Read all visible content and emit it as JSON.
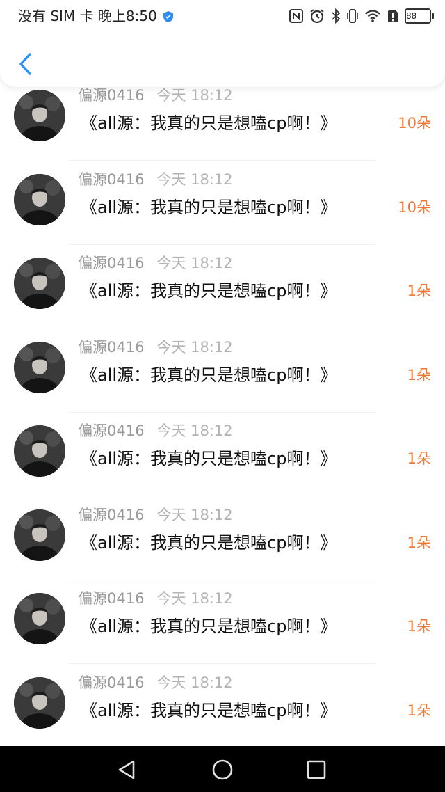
{
  "status_bar": {
    "left_text": "没有 SIM 卡 晚上8:50",
    "battery_level": "88",
    "icons": [
      "shield-icon",
      "nfc-icon",
      "alarm-icon",
      "bluetooth-icon",
      "vibrate-icon",
      "wifi-icon",
      "sim-alert-icon",
      "battery-icon"
    ]
  },
  "header": {
    "back_icon": "chevron-left-icon"
  },
  "colors": {
    "accent_blue": "#2b8ff5",
    "count_orange": "#ee7a36"
  },
  "list": {
    "items": [
      {
        "user": "偏源0416",
        "time": "今天 18:12",
        "title": "《all源：我真的只是想嗑cp啊！》",
        "count": "10朵"
      },
      {
        "user": "偏源0416",
        "time": "今天 18:12",
        "title": "《all源：我真的只是想嗑cp啊！》",
        "count": "10朵"
      },
      {
        "user": "偏源0416",
        "time": "今天 18:12",
        "title": "《all源：我真的只是想嗑cp啊！》",
        "count": "1朵"
      },
      {
        "user": "偏源0416",
        "time": "今天 18:12",
        "title": "《all源：我真的只是想嗑cp啊！》",
        "count": "1朵"
      },
      {
        "user": "偏源0416",
        "time": "今天 18:12",
        "title": "《all源：我真的只是想嗑cp啊！》",
        "count": "1朵"
      },
      {
        "user": "偏源0416",
        "time": "今天 18:12",
        "title": "《all源：我真的只是想嗑cp啊！》",
        "count": "1朵"
      },
      {
        "user": "偏源0416",
        "time": "今天 18:12",
        "title": "《all源：我真的只是想嗑cp啊！》",
        "count": "1朵"
      },
      {
        "user": "偏源0416",
        "time": "今天 18:12",
        "title": "《all源：我真的只是想嗑cp啊！》",
        "count": "1朵"
      }
    ]
  },
  "nav_bar": {
    "buttons": [
      "back-triangle-icon",
      "home-circle-icon",
      "recents-square-icon"
    ]
  }
}
